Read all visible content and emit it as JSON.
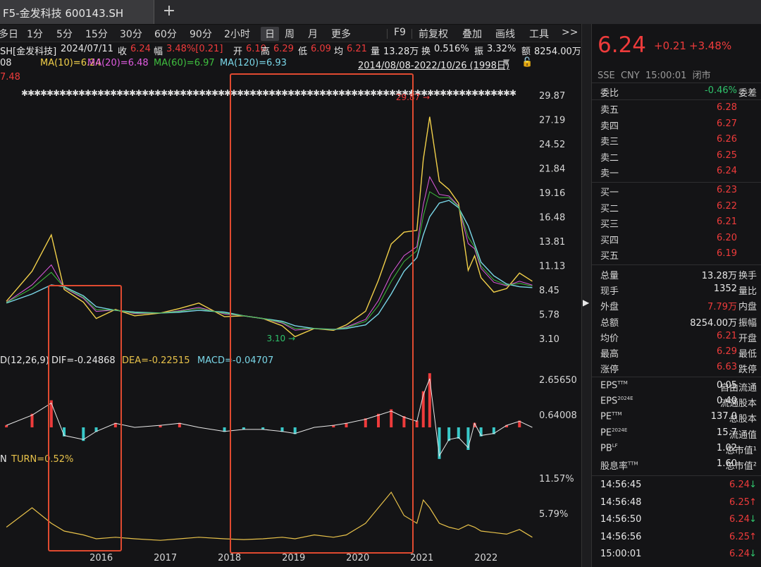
{
  "window": {
    "title": "F5-金发科技 600143.SH",
    "new_tab": "+"
  },
  "toolbar": {
    "items": [
      "多日",
      "1分",
      "5分",
      "15分",
      "30分",
      "60分",
      "90分",
      "2小时",
      "日",
      "周",
      "月",
      "更多"
    ],
    "active": "日",
    "right_items": [
      "F9",
      "前复权",
      "叠加",
      "画线",
      "工具",
      ">>"
    ]
  },
  "info": {
    "stock": "SH[金发科技]",
    "date": "2024/07/11",
    "close_label": "收",
    "close": "6.24",
    "change_label": "幅",
    "change": "3.48%[0.21]",
    "open_label": "开",
    "open": "6.10",
    "high_label": "高",
    "high": "6.29",
    "low_label": "低",
    "low": "6.09",
    "avg_label": "均",
    "avg": "6.21",
    "vol_label": "量",
    "vol": "13.28万",
    "turn_label": "换",
    "turn": "0.516%",
    "amp_label": "振",
    "amp": "3.32%",
    "amount_label": "额",
    "amount": "8254.00万"
  },
  "ma": {
    "ma5": "08",
    "ma10": "MA(10)=6.24",
    "ma20": "MA(20)=6.48",
    "ma60": "MA(60)=6.97",
    "ma120": "MA(120)=6.93",
    "range": "2014/08/08-2022/10/26 (1998日)",
    "sub": "7.48"
  },
  "colors": {
    "ma5": "#e6e6e6",
    "ma10": "#f2d04a",
    "ma20": "#e05be0",
    "ma60": "#3fbf3f",
    "ma120": "#7ad7e8",
    "up": "#ee3b3b",
    "down": "#39c9c9",
    "highlight": "#e04a30"
  },
  "chart_data": {
    "type": "line",
    "y_ticks": [
      "29.87",
      "27.19",
      "24.52",
      "21.84",
      "19.16",
      "16.48",
      "13.81",
      "11.13",
      "8.45",
      "5.78",
      "3.10"
    ],
    "x_labels": [
      "2016",
      "2017",
      "2018",
      "2019",
      "2020",
      "2021",
      "2022"
    ],
    "max_label": "29.87",
    "min_label": "3.10",
    "x": [
      2014.6,
      2015.0,
      2015.3,
      2015.5,
      2015.8,
      2016.0,
      2016.3,
      2016.6,
      2017.0,
      2017.3,
      2017.6,
      2018.0,
      2018.3,
      2018.6,
      2018.9,
      2019.1,
      2019.4,
      2019.7,
      2019.9,
      2020.2,
      2020.4,
      2020.6,
      2020.8,
      2021.0,
      2021.1,
      2021.2,
      2021.35,
      2021.5,
      2021.65,
      2021.8,
      2021.9,
      2022.0,
      2022.2,
      2022.4,
      2022.6,
      2022.8
    ],
    "series": [
      {
        "name": "MA(10)",
        "values": [
          7.2,
          10.5,
          14.5,
          8.5,
          7.1,
          5.3,
          6.3,
          5.6,
          5.9,
          6.4,
          7.0,
          5.5,
          5.6,
          5.3,
          4.5,
          3.3,
          4.2,
          4.0,
          4.6,
          6.1,
          9.5,
          13.5,
          14.8,
          15.0,
          22.8,
          27.5,
          20.4,
          19.5,
          18.0,
          10.6,
          12.2,
          9.8,
          8.2,
          8.6,
          10.3,
          9.4
        ]
      },
      {
        "name": "MA(120)",
        "values": [
          7.0,
          8.0,
          9.0,
          8.8,
          7.8,
          6.6,
          6.2,
          6.0,
          5.9,
          6.0,
          6.2,
          6.0,
          5.6,
          5.3,
          5.0,
          4.5,
          4.2,
          4.1,
          4.2,
          4.6,
          5.8,
          8.0,
          10.5,
          12.0,
          14.5,
          16.5,
          18.0,
          18.3,
          17.5,
          15.5,
          13.5,
          11.5,
          10.0,
          9.1,
          8.8,
          8.7
        ]
      }
    ]
  },
  "macd": {
    "label": "D(12,26,9)",
    "dif": "DIF=-0.24868",
    "dea": "DEA=-0.22515",
    "macd": "MACD=-0.04707",
    "ticks": [
      "2.65650",
      "0.64008"
    ],
    "values": [
      0.1,
      0.6,
      1.2,
      -0.4,
      -0.6,
      -0.2,
      0.2,
      0.0,
      0.1,
      0.2,
      0.0,
      -0.2,
      -0.1,
      -0.1,
      -0.2,
      -0.3,
      0.0,
      0.1,
      0.2,
      0.4,
      0.6,
      0.8,
      0.5,
      0.3,
      1.6,
      2.4,
      -1.4,
      -0.6,
      -0.5,
      -1.0,
      0.2,
      -0.4,
      -0.3,
      0.1,
      0.3,
      0.0
    ]
  },
  "turn": {
    "label": "N",
    "value": "TURN=0.52%",
    "ticks": [
      "11.57%",
      "5.79%"
    ],
    "values": [
      2.5,
      5,
      3,
      2,
      1.5,
      1,
      1.2,
      1,
      0.8,
      1,
      1.2,
      1,
      0.9,
      1,
      1.2,
      1,
      1.5,
      1.2,
      1.5,
      3,
      5,
      7,
      4,
      3,
      6,
      5,
      3,
      2.5,
      2.2,
      2.8,
      2.5,
      2,
      1.8,
      1.6,
      2.2,
      1.2
    ]
  },
  "quote": {
    "price": "6.24",
    "change": "+0.21",
    "pct": "+3.48%",
    "sub": "SSE  CNY  15:00:01  闭市",
    "weibi_label": "委比",
    "weibi": "-0.46%",
    "weicha_label": "委差",
    "asks": [
      {
        "label": "卖五",
        "price": "6.28"
      },
      {
        "label": "卖四",
        "price": "6.27"
      },
      {
        "label": "卖三",
        "price": "6.26"
      },
      {
        "label": "卖二",
        "price": "6.25"
      },
      {
        "label": "卖一",
        "price": "6.24"
      }
    ],
    "bids": [
      {
        "label": "买一",
        "price": "6.23"
      },
      {
        "label": "买二",
        "price": "6.22"
      },
      {
        "label": "买三",
        "price": "6.21"
      },
      {
        "label": "买四",
        "price": "6.20"
      },
      {
        "label": "买五",
        "price": "6.19"
      }
    ],
    "stats": [
      {
        "l": "总量",
        "v": "13.28万",
        "r": "换手",
        "c": "white"
      },
      {
        "l": "现手",
        "v": "1352",
        "r": "量比",
        "c": "white"
      },
      {
        "l": "外盘",
        "v": "7.79万",
        "r": "内盘",
        "c": "red"
      },
      {
        "l": "总额",
        "v": "8254.00万",
        "r": "振幅",
        "c": "white"
      },
      {
        "l": "均价",
        "v": "6.21",
        "r": "开盘",
        "c": "red"
      },
      {
        "l": "最高",
        "v": "6.29",
        "r": "最低",
        "c": "red"
      },
      {
        "l": "涨停",
        "v": "6.63",
        "r": "跌停",
        "c": "red"
      }
    ],
    "fund": [
      {
        "l": "EPS",
        "sup": "TTM",
        "v": "0.05",
        "r": "自由流通"
      },
      {
        "l": "EPS",
        "sup": "2024E",
        "v": "0.40",
        "r": "流通股本"
      },
      {
        "l": "PE",
        "sup": "TTM",
        "v": "137.0",
        "r": "总股本"
      },
      {
        "l": "PE",
        "sup": "2024E",
        "v": "15.7",
        "r": "流通值"
      },
      {
        "l": "PB",
        "sup": "LF",
        "v": "1.02",
        "r": "总市值¹"
      },
      {
        "l": "股息率",
        "sup": "TTM",
        "v": "1.60",
        "r": "总市值²"
      }
    ],
    "ticks": [
      {
        "t": "14:56:45",
        "p": "6.24",
        "d": "down"
      },
      {
        "t": "14:56:48",
        "p": "6.25",
        "d": "up"
      },
      {
        "t": "14:56:50",
        "p": "6.24",
        "d": "down"
      },
      {
        "t": "14:56:56",
        "p": "6.25",
        "d": "up"
      },
      {
        "t": "15:00:01",
        "p": "6.24",
        "d": "down"
      }
    ]
  }
}
